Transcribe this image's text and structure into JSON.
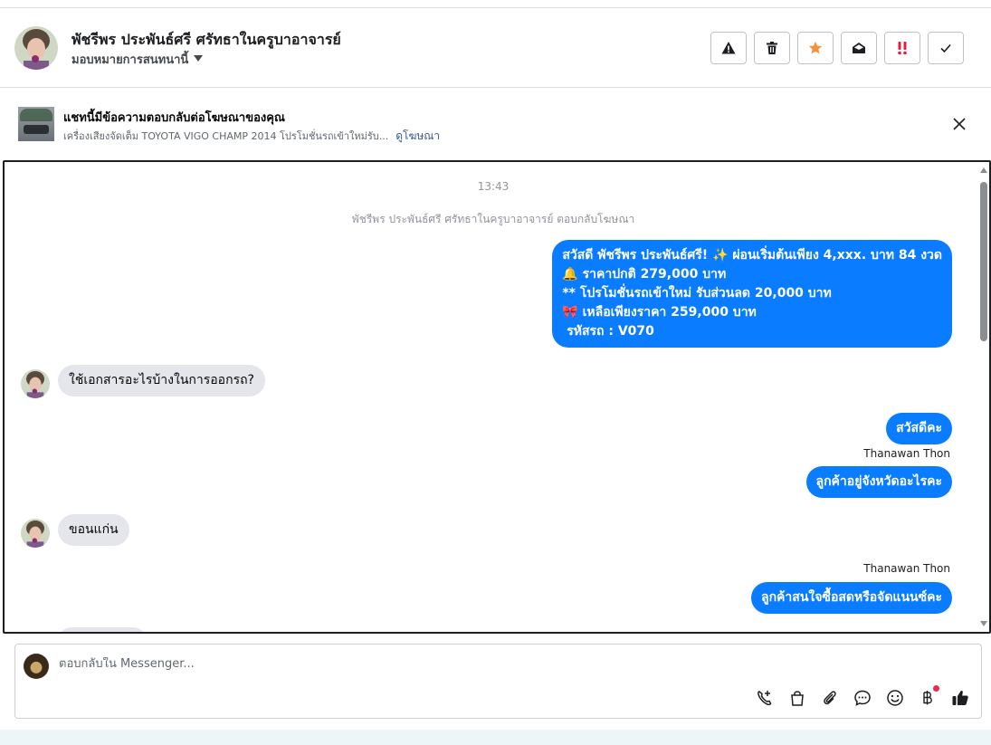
{
  "header": {
    "contact_name": "พัชรีพร ประพันธ์ศรี ศรัทธาในครูบาอาจารย์",
    "assign_label": "มอบหมายการสนทนานี้",
    "actions": [
      "alert-icon",
      "trash-icon",
      "star-icon",
      "mark-read-icon",
      "important-icon",
      "check-icon"
    ]
  },
  "ad": {
    "title": "แชทนี้มีข้อความตอบกลับต่อโฆษณาของคุณ",
    "description": "เครื่องเสียงจัดเต็ม TOYOTA VIGO CHAMP 2014 โปรโมชั่นรถเข้าใหม่รับ...",
    "link": "ดูโฆษณา"
  },
  "chat": {
    "timestamp": "13:43",
    "system_note": "พัชรีพร ประพันธ์ศรี ศรัทธาในครูบาอาจารย์ ตอบกลับโฆษณา",
    "promo_lines": [
      "สวัสดี พัชรีพร ประพันธ์ศรี! ✨  ผ่อนเริ่มต้นเพียง 4,xxx. บาท 84 งวด",
      "🔔 ราคาปกติ 279,000 บาท",
      "** โปรโมชั่นรถเข้าใหม่ รับส่วนลด 20,000 บาท",
      "🎀  เหลือเพียงราคา 259,000 บาท",
      " รหัสรถ : V070"
    ],
    "msg_customer_1": "ใช้เอกสารอะไรบ้างในการออกรถ?",
    "msg_agent_1": "สวัสดีคะ",
    "agent_name_1": "Thanawan Thon",
    "msg_agent_2": "ลูกค้าอยู่จังหวัดอะไรคะ",
    "msg_customer_2": "ขอนแก่น",
    "agent_name_2": "Thanawan Thon",
    "msg_agent_3": "ลูกค้าสนใจซื้อสดหรือจัดแนนซ์คะ"
  },
  "composer": {
    "placeholder": "ตอบกลับใน Messenger...",
    "tools": [
      "call-icon",
      "shopping-bag-icon",
      "attachment-icon",
      "saved-reply-icon",
      "emoji-icon",
      "baht-icon",
      "like-icon"
    ]
  },
  "colors": {
    "outgoing": "#0a7cff",
    "incoming": "#e4e6eb",
    "star": "#f7923b",
    "important": "#e41e3f"
  }
}
